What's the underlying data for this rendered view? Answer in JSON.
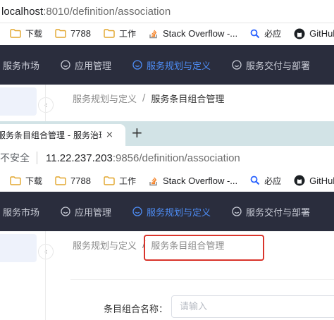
{
  "top_window": {
    "address": {
      "host": "localhost",
      "path": ":8010/definition/association"
    },
    "bookmarks": [
      {
        "label": "下载",
        "icon": "folder-icon"
      },
      {
        "label": "7788",
        "icon": "folder-icon"
      },
      {
        "label": "工作",
        "icon": "folder-icon"
      },
      {
        "label": "Stack Overflow -...",
        "icon": "stackoverflow-icon"
      },
      {
        "label": "必应",
        "icon": "bing-search-icon"
      },
      {
        "label": "GitHub",
        "icon": "github-icon"
      }
    ],
    "nav": [
      {
        "label": "服务市场",
        "icon": ""
      },
      {
        "label": "应用管理",
        "icon": "smile-icon"
      },
      {
        "label": "服务规划与定义",
        "icon": "smile-icon",
        "active": true
      },
      {
        "label": "服务交付与部署",
        "icon": "smile-icon"
      }
    ],
    "breadcrumb": {
      "parent": "服务规划与定义",
      "separator": "/",
      "current": "服务条目组合管理"
    }
  },
  "bottom_window": {
    "tab": {
      "title": "服务条目组合管理 - 服务治理中心",
      "close": "×",
      "new_tab": "+"
    },
    "address": {
      "security": "不安全",
      "host": "11.22.237.203",
      "path": ":9856/definition/association"
    },
    "bookmarks": [
      {
        "label": "下载",
        "icon": "folder-icon"
      },
      {
        "label": "7788",
        "icon": "folder-icon"
      },
      {
        "label": "工作",
        "icon": "folder-icon"
      },
      {
        "label": "Stack Overflow -...",
        "icon": "stackoverflow-icon"
      },
      {
        "label": "必应",
        "icon": "bing-search-icon"
      },
      {
        "label": "GitHub",
        "icon": "github-icon"
      }
    ],
    "nav": [
      {
        "label": "服务市场",
        "icon": ""
      },
      {
        "label": "应用管理",
        "icon": "smile-icon"
      },
      {
        "label": "服务规划与定义",
        "icon": "smile-icon",
        "active": true
      },
      {
        "label": "服务交付与部署",
        "icon": "smile-icon"
      }
    ],
    "breadcrumb": {
      "parent": "服务规划与定义",
      "separator": "/",
      "current": "服务条目组合管理"
    },
    "form": {
      "label": "条目组合名称：",
      "placeholder": "请输入",
      "value": ""
    }
  },
  "colors": {
    "nav_bg": "#2a2d3d",
    "nav_active": "#4e8ef7",
    "highlight_border": "#d9342b",
    "tabstrip_bg": "#d2e3e6"
  }
}
